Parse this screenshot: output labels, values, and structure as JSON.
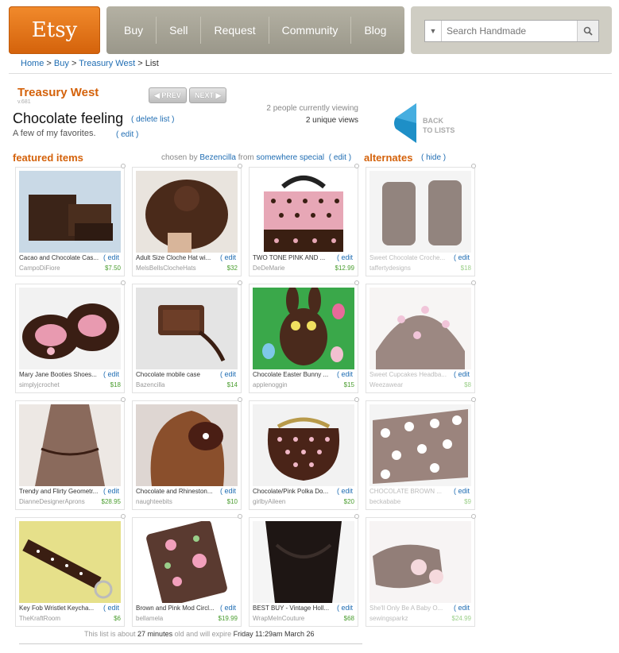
{
  "header": {
    "logo": "Etsy",
    "nav": [
      "Buy",
      "Sell",
      "Request",
      "Community",
      "Blog"
    ],
    "search_placeholder": "Search Handmade"
  },
  "breadcrumb": {
    "home": "Home",
    "sep": ">",
    "buy": "Buy",
    "treasury": "Treasury West",
    "current": "List"
  },
  "treasury": {
    "title": "Treasury West",
    "subtitle": "v.681",
    "prev": "PREV",
    "next": "NEXT"
  },
  "list": {
    "title": "Chocolate feeling",
    "delete_label": "delete list",
    "description": "A few of my favorites.",
    "edit_label": "edit",
    "viewing": "2 people currently viewing",
    "unique_views": "2 unique views",
    "back_label_1": "BACK",
    "back_label_2": "TO LISTS"
  },
  "featured": {
    "heading": "featured items",
    "chosen_by": "chosen by",
    "curator": "Bezencilla",
    "from": "from",
    "location": "somewhere special",
    "edit": "edit"
  },
  "alternates": {
    "heading": "alternates",
    "hide": "hide"
  },
  "cards": [
    {
      "title": "Cacao and Chocolate Cas...",
      "seller": "CampoDiFiore",
      "price": "$7.50",
      "edit": "edit",
      "icon": "chocolate-soap"
    },
    {
      "title": "Adult Size Cloche Hat wi...",
      "seller": "MelsBellsClocheHats",
      "price": "$32",
      "edit": "edit",
      "icon": "cloche-hat"
    },
    {
      "title": "TWO TONE PINK AND ...",
      "seller": "DeDeMarie",
      "price": "$12.99",
      "edit": "edit",
      "icon": "polka-bag"
    },
    {
      "title": "Sweet Chocolate Croche...",
      "seller": "taffertydesigns",
      "price": "$18",
      "edit": "edit",
      "icon": "crochet-mitts"
    },
    {
      "title": "Mary Jane Booties Shoes...",
      "seller": "simplyjcrochet",
      "price": "$18",
      "edit": "edit",
      "icon": "booties"
    },
    {
      "title": "Chocolate mobile case",
      "seller": "Bazencilla",
      "price": "$14",
      "edit": "edit",
      "icon": "mobile-case"
    },
    {
      "title": "Chocolate Easter Bunny ...",
      "seller": "applenoggin",
      "price": "$15",
      "edit": "edit",
      "icon": "bunny"
    },
    {
      "title": "Sweet Cupcakes Headba...",
      "seller": "Weezawear",
      "price": "$8",
      "edit": "edit",
      "icon": "headband"
    },
    {
      "title": "Trendy and Flirty Geometr...",
      "seller": "DianneDesignerAprons",
      "price": "$28.95",
      "edit": "edit",
      "icon": "apron"
    },
    {
      "title": "Chocolate and Rhineston...",
      "seller": "naughteebits",
      "price": "$10",
      "edit": "edit",
      "icon": "hair-flower"
    },
    {
      "title": "Chocolate/Pink Polka Do...",
      "seller": "girlbyAileen",
      "price": "$20",
      "edit": "edit",
      "icon": "coin-purse"
    },
    {
      "title": "CHOCOLATE BROWN ...",
      "seller": "beckababe",
      "price": "$9",
      "edit": "edit",
      "icon": "dot-band"
    },
    {
      "title": "Key Fob Wristlet Keycha...",
      "seller": "TheKraftRoom",
      "price": "$6",
      "edit": "edit",
      "icon": "key-fob"
    },
    {
      "title": "Brown and Pink Mod Circl...",
      "seller": "bellamela",
      "price": "$19.99",
      "edit": "edit",
      "icon": "mod-pouch"
    },
    {
      "title": "BEST BUY - Vintage Holl...",
      "seller": "WrapMeInCouture",
      "price": "$68",
      "edit": "edit",
      "icon": "wrap"
    },
    {
      "title": "She'll Only Be A Baby O...",
      "seller": "sewingsparkz",
      "price": "$24.99",
      "edit": "edit",
      "icon": "baby-shoes"
    }
  ],
  "footer": {
    "pre": "This list is about",
    "age": "27 minutes",
    "mid": "old and will expire",
    "expiry": "Friday 11:29am  March 26"
  }
}
